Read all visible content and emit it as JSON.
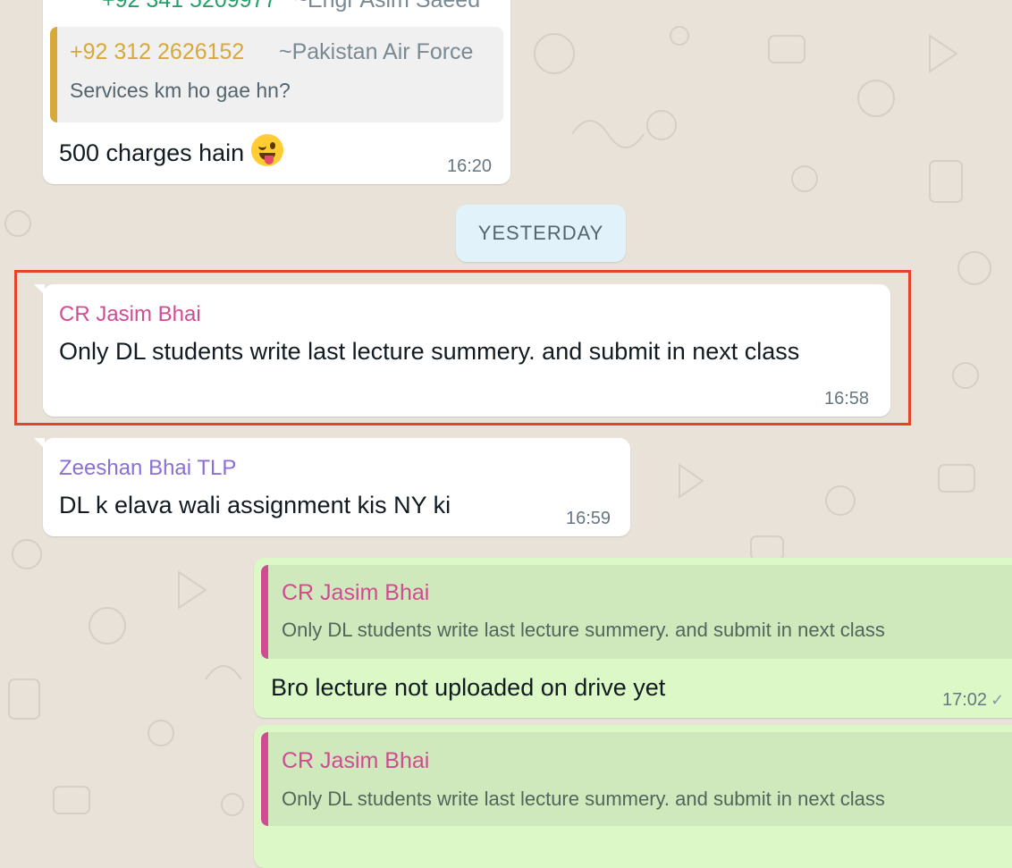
{
  "colors": {
    "chat_background": "#e8e2d9",
    "incoming_bubble": "#ffffff",
    "outgoing_bubble": "#dcf8c6",
    "date_chip": "#e1f2fb",
    "highlight_border": "#e5432a",
    "author_pink": "#d14b93",
    "author_purple": "#8a6fd6",
    "author_gold": "#d6a93a",
    "author_green": "#25a06b"
  },
  "messages": {
    "top": {
      "cut_header_phone": "+92 341 5209977",
      "cut_header_name": "~Engr Asim Saeed",
      "quote_phone": "+92 312 2626152",
      "quote_name": "~Pakistan Air Force",
      "quote_text": "Services km ho gae hn?",
      "text": "500 charges hain",
      "emoji": "winking-face-with-tongue",
      "time": "16:20"
    },
    "date_separator": "YESTERDAY",
    "cr": {
      "sender": "CR Jasim Bhai",
      "text": "Only DL students write last lecture summery. and submit in next class",
      "time": "16:58"
    },
    "zeeshan": {
      "sender": "Zeeshan Bhai TLP",
      "text": "DL k elava wali assignment kis NY ki",
      "time": "16:59"
    },
    "reply1": {
      "quote_author": "CR Jasim Bhai",
      "quote_text": "Only DL students write last lecture summery. and submit in next class",
      "text": "Bro lecture not uploaded on drive yet",
      "time": "17:02",
      "status": "sent-check"
    },
    "reply2": {
      "quote_author": "CR Jasim Bhai",
      "quote_text": "Only DL students write last lecture summery. and submit in next class"
    }
  }
}
